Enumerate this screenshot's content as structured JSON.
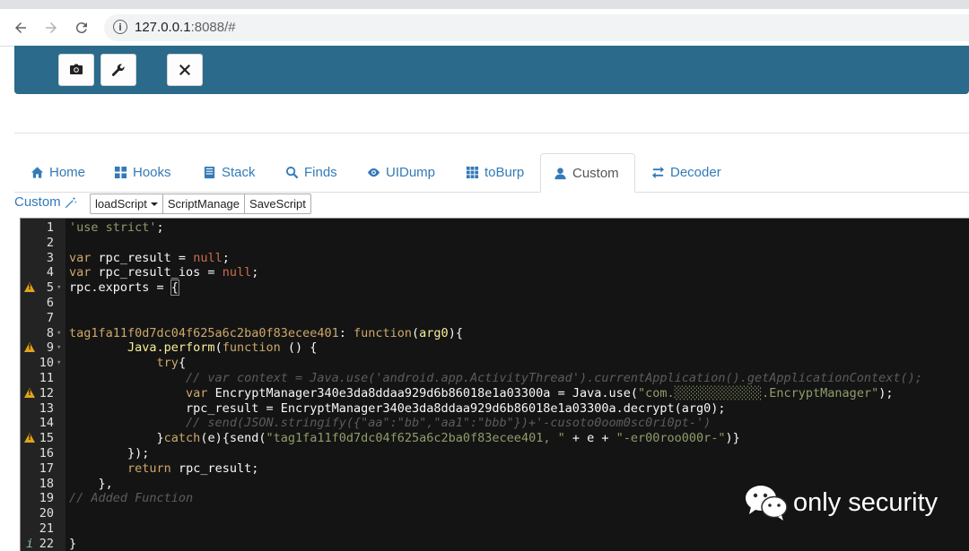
{
  "browser": {
    "url_host": "127.0.0.1",
    "url_rest": ":8088/#"
  },
  "tabs": [
    {
      "label": "Home",
      "icon": "home-icon"
    },
    {
      "label": "Hooks",
      "icon": "grid-icon"
    },
    {
      "label": "Stack",
      "icon": "stack-icon"
    },
    {
      "label": "Finds",
      "icon": "search-icon"
    },
    {
      "label": "UIDump",
      "icon": "eye-icon"
    },
    {
      "label": "toBurp",
      "icon": "grid-dots-icon"
    },
    {
      "label": "Custom",
      "icon": "user-icon",
      "active": true
    },
    {
      "label": "Decoder",
      "icon": "swap-icon"
    }
  ],
  "custom": {
    "label": "Custom",
    "buttons": {
      "load_script": "loadScript",
      "script_manage": "ScriptManage",
      "save_script": "SaveScript"
    }
  },
  "editor": {
    "theme_colors": {
      "background": "#141414",
      "gutter": "#232323",
      "warning": "#e2a31b"
    },
    "lines": [
      {
        "n": "1",
        "t": "'use strict';"
      },
      {
        "n": "2",
        "t": ""
      },
      {
        "n": "3",
        "t": "var rpc_result = null;"
      },
      {
        "n": "4",
        "t": "var rpc_result_ios = null;"
      },
      {
        "n": "5",
        "t": "rpc.exports = {",
        "warn": true
      },
      {
        "n": "6",
        "t": ""
      },
      {
        "n": "7",
        "t": ""
      },
      {
        "n": "8",
        "t": "tag1fa11f0d7dc04f625a6c2ba0f83ecee401: function(arg0){"
      },
      {
        "n": "9",
        "t": "Java.perform(function () {",
        "warn": true
      },
      {
        "n": "10",
        "t": "try{"
      },
      {
        "n": "11",
        "t": "// var context = Java.use('android.app.ActivityThread').currentApplication().getApplicationContext();"
      },
      {
        "n": "12",
        "t": "var EncryptManager340e3da8ddaa929d6b86018e1a03300a = Java.use(\"com.░░░░░░░░░░░░.EncryptManager\");",
        "warn": true
      },
      {
        "n": "13",
        "t": "rpc_result = EncryptManager340e3da8ddaa929d6b86018e1a03300a.decrypt(arg0);"
      },
      {
        "n": "14",
        "t": "// send(JSON.stringify({\"aa\":\"bb\",\"aa1\":\"bbb\"})+'-cusoto0oom0sc0ri0pt-')"
      },
      {
        "n": "15",
        "t": "}catch(e){send(\"tag1fa11f0d7dc04f625a6c2ba0f83ecee401, \" + e + \"-er00roo000r-\")}",
        "warn": true
      },
      {
        "n": "16",
        "t": "});"
      },
      {
        "n": "17",
        "t": "return rpc_result;"
      },
      {
        "n": "18",
        "t": "},"
      },
      {
        "n": "19",
        "t": "// Added Function"
      },
      {
        "n": "20",
        "t": ""
      },
      {
        "n": "21",
        "t": ""
      },
      {
        "n": "22",
        "t": "}",
        "info": true
      }
    ]
  },
  "watermark": {
    "text": "only security"
  }
}
